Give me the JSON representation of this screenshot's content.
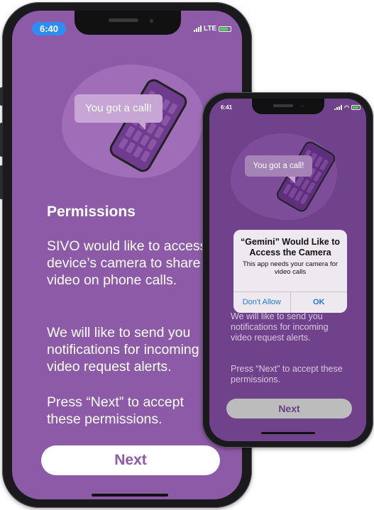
{
  "big_phone": {
    "status": {
      "time": "6:40",
      "network": "LTE"
    },
    "bubble_text": "You got a call!",
    "heading": "Permissions",
    "para1": "SIVO would like to access this device’s camera to share your video on phone calls.",
    "para2": "We will like to send you notifications for incoming video request alerts.",
    "para3": "Press “Next” to accept these permissions.",
    "next_label": "Next"
  },
  "small_phone": {
    "status": {
      "time": "6:41"
    },
    "bubble_text": "You got a call!",
    "dialog": {
      "title": "“Gemini” Would Like to Access the Camera",
      "message": "This app needs your camera for video calls",
      "deny_label": "Don't Allow",
      "ok_label": "OK"
    },
    "para2": "We will like to send you notifications for incoming video request alerts.",
    "para3": "Press “Next” to accept these permissions.",
    "next_label": "Next"
  },
  "colors": {
    "screen_big": "#8d5aa7",
    "screen_small": "#70428c",
    "accent_blue": "#2f8cf5",
    "next_text": "#8d5aa7"
  }
}
